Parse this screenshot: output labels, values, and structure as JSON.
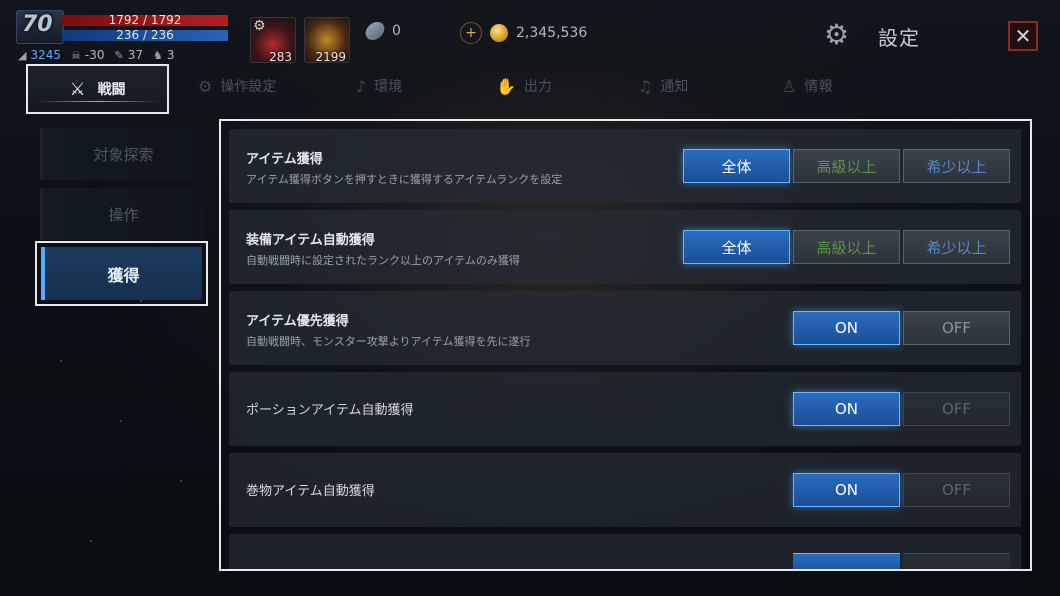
{
  "player": {
    "level": "70",
    "hp_text": "1792 / 1792",
    "mp_text": "236 / 236",
    "stats": [
      {
        "icon": "wing-icon",
        "value": "3245"
      },
      {
        "icon": "skull-icon",
        "value": "-30"
      },
      {
        "icon": "feather-icon",
        "value": "37"
      },
      {
        "icon": "monster-icon",
        "value": "3"
      }
    ]
  },
  "quick_items": [
    {
      "name": "potion-slot",
      "count": "283"
    },
    {
      "name": "scroll-slot",
      "count": "2199"
    }
  ],
  "currency": {
    "gem": "0",
    "gold": "2,345,536",
    "plus_label": "+"
  },
  "header": {
    "title": "設定",
    "close_label": "✕"
  },
  "tabs": [
    {
      "label": "戦闘",
      "icon": "crossed-swords-icon"
    },
    {
      "label": "操作設定",
      "icon": "gear-icon"
    },
    {
      "label": "環境",
      "icon": "music-note-icon"
    },
    {
      "label": "出力",
      "icon": "hand-icon"
    },
    {
      "label": "通知",
      "icon": "bell-icon"
    },
    {
      "label": "情報",
      "icon": "user-icon"
    }
  ],
  "sidebar": {
    "items": [
      {
        "label": "対象探索"
      },
      {
        "label": "操作"
      },
      {
        "label": "獲得"
      }
    ]
  },
  "settings": [
    {
      "title": "アイテム獲得",
      "description": "アイテム獲得ボタンを押すときに獲得するアイテムランクを設定",
      "options": [
        "全体",
        "高級以上",
        "希少以上"
      ],
      "selected": "全体"
    },
    {
      "title": "装備アイテム自動獲得",
      "description": "自動戦闘時に設定されたランク以上のアイテムのみ獲得",
      "options": [
        "全体",
        "高級以上",
        "希少以上"
      ],
      "selected": "全体"
    },
    {
      "title": "アイテム優先獲得",
      "description": "自動戦闘時、モンスター攻撃よりアイテム獲得を先に遂行",
      "options": [
        "ON",
        "OFF"
      ],
      "selected": "ON"
    },
    {
      "title": "ポーションアイテム自動獲得",
      "description": "",
      "options": [
        "ON",
        "OFF"
      ],
      "selected": "ON"
    },
    {
      "title": "巻物アイテム自動獲得",
      "description": "",
      "options": [
        "ON",
        "OFF"
      ],
      "selected": "ON"
    }
  ]
}
